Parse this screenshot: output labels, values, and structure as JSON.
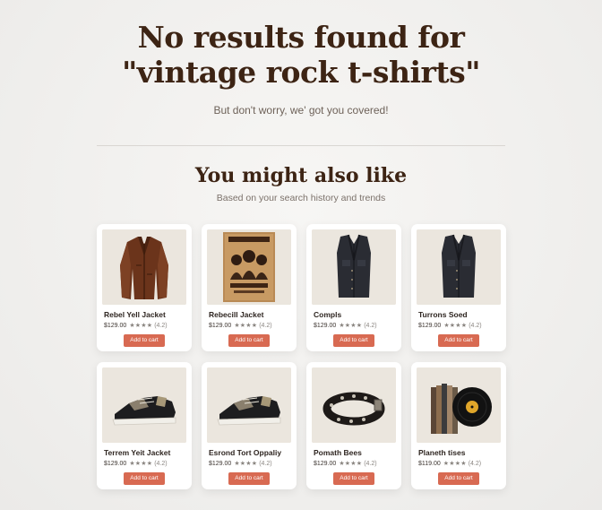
{
  "header": {
    "title_line1": "No results found for",
    "title_line2": "\"vintage rock t-shirts\"",
    "subtitle": "But don't worry, we' got you covered!"
  },
  "recommendations": {
    "title": "You might also like",
    "subtitle": "Based on your search history and trends",
    "products": [
      {
        "name": "Rebel Yell Jacket",
        "price": "$129.00",
        "stars": "★★★★",
        "rating": "(4.2)",
        "button": "Add to cart",
        "image_icon": "leather-jacket-icon"
      },
      {
        "name": "Rebecill Jacket",
        "price": "$129.00",
        "stars": "★★★★",
        "rating": "(4.2)",
        "button": "Add to cart",
        "image_icon": "band-poster-icon"
      },
      {
        "name": "Compls",
        "price": "$129.00",
        "stars": "★★★★",
        "rating": "(4.2)",
        "button": "Add to cart",
        "image_icon": "denim-vest-icon"
      },
      {
        "name": "Turrons Soed",
        "price": "$129.00",
        "stars": "★★★★",
        "rating": "(4.2)",
        "button": "Add to cart",
        "image_icon": "denim-vest-icon"
      },
      {
        "name": "Terrem Yeit Jacket",
        "price": "$129.00",
        "stars": "★★★★",
        "rating": "(4.2)",
        "button": "Add to cart",
        "image_icon": "sneaker-icon"
      },
      {
        "name": "Esrond Tort Oppaliy",
        "price": "$129.00",
        "stars": "★★★★",
        "rating": "(4.2)",
        "button": "Add to cart",
        "image_icon": "sneaker-icon"
      },
      {
        "name": "Pomath Bees",
        "price": "$129.00",
        "stars": "★★★★",
        "rating": "(4.2)",
        "button": "Add to cart",
        "image_icon": "studded-collar-icon"
      },
      {
        "name": "Planeth tises",
        "price": "$119.00",
        "stars": "★★★★",
        "rating": "(4.2)",
        "button": "Add to cart",
        "image_icon": "vinyl-records-icon"
      }
    ]
  },
  "colors": {
    "accent_button": "#d86a52",
    "heading": "#3d2414",
    "background": "#f2f1ef"
  }
}
